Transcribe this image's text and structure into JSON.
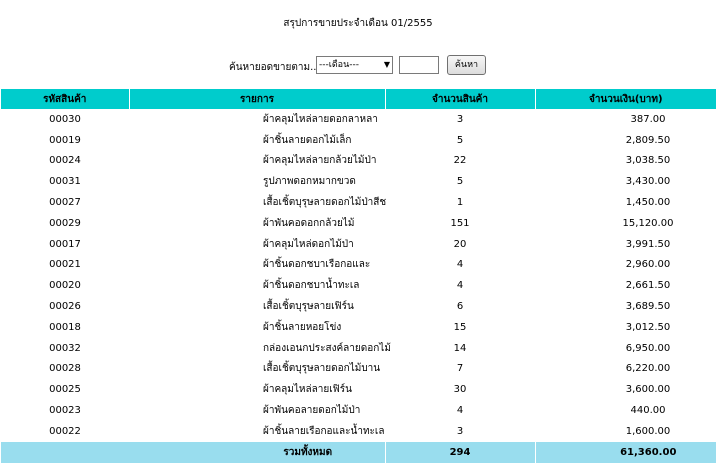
{
  "report": {
    "title": "สรุปการขายประจำเดือน 01/2555"
  },
  "search": {
    "label": "ค้นหายอดขายตาม...",
    "month_select_value": "---เดือน---",
    "year_value": "",
    "button_label": "ค้นหา"
  },
  "table": {
    "headers": {
      "code": "รหัสสินค้า",
      "name": "รายการ",
      "qty": "จำนวนสินค้า",
      "amount": "จำนวนเงิน(บาท)"
    },
    "rows": [
      {
        "code": "00030",
        "name": "ผ้าคลุมไหล่ลายดอกลาหลา",
        "qty": "3",
        "amount": "387.00"
      },
      {
        "code": "00019",
        "name": "ผ้าชิ้นลายดอกไม้เล็ก",
        "qty": "5",
        "amount": "2,809.50"
      },
      {
        "code": "00024",
        "name": "ผ้าคลุมไหล่ลายกล้วยไม้ป่า",
        "qty": "22",
        "amount": "3,038.50"
      },
      {
        "code": "00031",
        "name": "รูปภาพดอกหมากขวด",
        "qty": "5",
        "amount": "3,430.00"
      },
      {
        "code": "00027",
        "name": "เสื้อเชิ้ตบุรุษลายดอกไม้ป่าสีช",
        "qty": "1",
        "amount": "1,450.00"
      },
      {
        "code": "00029",
        "name": "ผ้าพันคอดอกกล้วยไม้",
        "qty": "151",
        "amount": "15,120.00"
      },
      {
        "code": "00017",
        "name": "ผ้าคลุมไหล่ดอกไม้ป่า",
        "qty": "20",
        "amount": "3,991.50"
      },
      {
        "code": "00021",
        "name": "ผ้าชิ้นดอกชบาเรือกอและ",
        "qty": "4",
        "amount": "2,960.00"
      },
      {
        "code": "00020",
        "name": "ผ้าชิ้นดอกชบาน้ำทะเล",
        "qty": "4",
        "amount": "2,661.50"
      },
      {
        "code": "00026",
        "name": "เสื้อเชิ้ตบุรุษลายเฟิร์น",
        "qty": "6",
        "amount": "3,689.50"
      },
      {
        "code": "00018",
        "name": "ผ้าชิ้นลายหอยโข่ง",
        "qty": "15",
        "amount": "3,012.50"
      },
      {
        "code": "00032",
        "name": "กล่องเอนกประสงค์ลายดอกไม้",
        "qty": "14",
        "amount": "6,950.00"
      },
      {
        "code": "00028",
        "name": "เสื้อเชิ้ตบุรุษลายดอกไม้บาน",
        "qty": "7",
        "amount": "6,220.00"
      },
      {
        "code": "00025",
        "name": "ผ้าคลุมไหล่ลายเฟิร์น",
        "qty": "30",
        "amount": "3,600.00"
      },
      {
        "code": "00023",
        "name": "ผ้าพันคอลายดอกไม้ป่า",
        "qty": "4",
        "amount": "440.00"
      },
      {
        "code": "00022",
        "name": "ผ้าชิ้นลายเรือกอและน้ำทะเล",
        "qty": "3",
        "amount": "1,600.00"
      }
    ],
    "footer": {
      "label": "รวมทั้งหมด",
      "qty_total": "294",
      "amount_total": "61,360.00"
    }
  },
  "colors": {
    "header_bg": "#00cccc",
    "footer_bg": "#99ddee"
  }
}
